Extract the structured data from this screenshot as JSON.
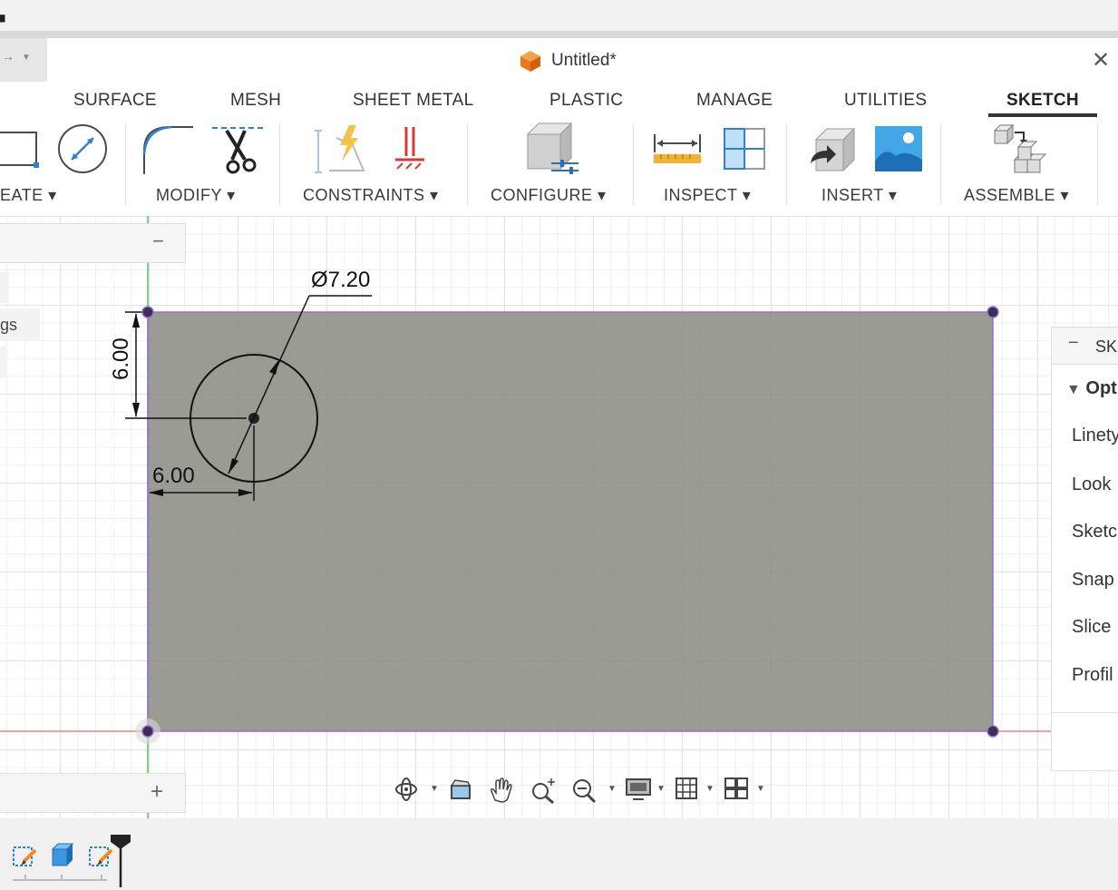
{
  "document": {
    "title": "Untitled*"
  },
  "tabs": [
    {
      "label": "SURFACE",
      "active": false
    },
    {
      "label": "MESH",
      "active": false
    },
    {
      "label": "SHEET METAL",
      "active": false
    },
    {
      "label": "PLASTIC",
      "active": false
    },
    {
      "label": "MANAGE",
      "active": false
    },
    {
      "label": "UTILITIES",
      "active": false
    },
    {
      "label": "SKETCH",
      "active": true
    }
  ],
  "toolbar_groups": [
    {
      "label": "EATE ▾",
      "icons": [
        "rectangle-icon",
        "circle-icon"
      ]
    },
    {
      "label": "MODIFY ▾",
      "icons": [
        "fillet-icon",
        "trim-scissors-icon"
      ]
    },
    {
      "label": "CONSTRAINTS ▾",
      "icons": [
        "constraints-icon",
        "fix-constraint-icon"
      ]
    },
    {
      "label": "CONFIGURE ▾",
      "icons": [
        "configure-cube-icon"
      ]
    },
    {
      "label": "INSPECT ▾",
      "icons": [
        "measure-ruler-icon",
        "section-analysis-icon"
      ]
    },
    {
      "label": "INSERT ▾",
      "icons": [
        "insert-derive-icon",
        "insert-image-icon"
      ]
    },
    {
      "label": "ASSEMBLE ▾",
      "icons": [
        "assemble-components-icon"
      ]
    }
  ],
  "browser": {
    "partial_item": "gs"
  },
  "sketch": {
    "diameter_label": "Ø7.20",
    "vertical_dim_label": "6.00",
    "horizontal_dim_label": "6.00"
  },
  "side_panel": {
    "title": "SK",
    "section": "Opt",
    "rows": [
      "Linety",
      "Look",
      "Sketc",
      "Snap",
      "Slice",
      "Profil"
    ]
  },
  "colors": {
    "sketch_fill": "#9a9b91",
    "sketch_edge": "#9470d0",
    "axis_green": "#56c456",
    "axis_red": "#e05050",
    "accent_orange": "#f08a24"
  }
}
